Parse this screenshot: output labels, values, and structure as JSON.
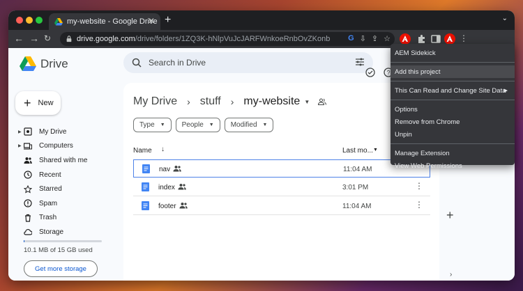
{
  "browser": {
    "tab_title": "my-website - Google Drive",
    "tab_close": "✕",
    "new_tab": "+",
    "tab_menu": "⌄",
    "url_host": "drive.google.com",
    "url_path": "/drive/folders/1ZQ3K-hNlpVuJcJARFWnkoeRnbOvZKonb"
  },
  "drive": {
    "logo_text": "Drive",
    "search_placeholder": "Search in Drive",
    "new_label": "New",
    "nav": [
      {
        "label": "My Drive",
        "icon": "my-drive-icon",
        "caret": true
      },
      {
        "label": "Computers",
        "icon": "computers-icon",
        "caret": true
      },
      {
        "label": "Shared with me",
        "icon": "shared-icon",
        "caret": false
      },
      {
        "label": "Recent",
        "icon": "clock-icon",
        "caret": false
      },
      {
        "label": "Starred",
        "icon": "star-icon",
        "caret": false
      },
      {
        "label": "Spam",
        "icon": "spam-icon",
        "caret": false
      },
      {
        "label": "Trash",
        "icon": "trash-icon",
        "caret": false
      },
      {
        "label": "Storage",
        "icon": "cloud-icon",
        "caret": false
      }
    ],
    "storage_used": "10.1 MB of 15 GB used",
    "get_storage": "Get more storage",
    "breadcrumb": [
      "My Drive",
      "stuff",
      "my-website"
    ],
    "filters": [
      "Type",
      "People",
      "Modified"
    ],
    "columns": {
      "name": "Name",
      "last_modified": "Last mo..."
    },
    "files": [
      {
        "name": "nav",
        "modified": "11:04 AM",
        "selected": true
      },
      {
        "name": "index",
        "modified": "3:01 PM",
        "selected": false
      },
      {
        "name": "footer",
        "modified": "11:04 AM",
        "selected": false
      }
    ]
  },
  "extension_menu": {
    "items": [
      {
        "label": "AEM Sidekick",
        "highlight": false
      },
      {
        "sep": true
      },
      {
        "label": "Add this project",
        "highlight": true
      },
      {
        "sep": true
      },
      {
        "label": "This Can Read and Change Site Data",
        "submenu": true
      },
      {
        "sep": true
      },
      {
        "label": "Options"
      },
      {
        "label": "Remove from Chrome"
      },
      {
        "label": "Unpin"
      },
      {
        "sep": true
      },
      {
        "label": "Manage Extension"
      },
      {
        "label": "View Web Permissions"
      }
    ]
  },
  "colors": {
    "accent": "#0b57d0",
    "menu_bg": "#35363a",
    "adobe_red": "#eb1000"
  }
}
